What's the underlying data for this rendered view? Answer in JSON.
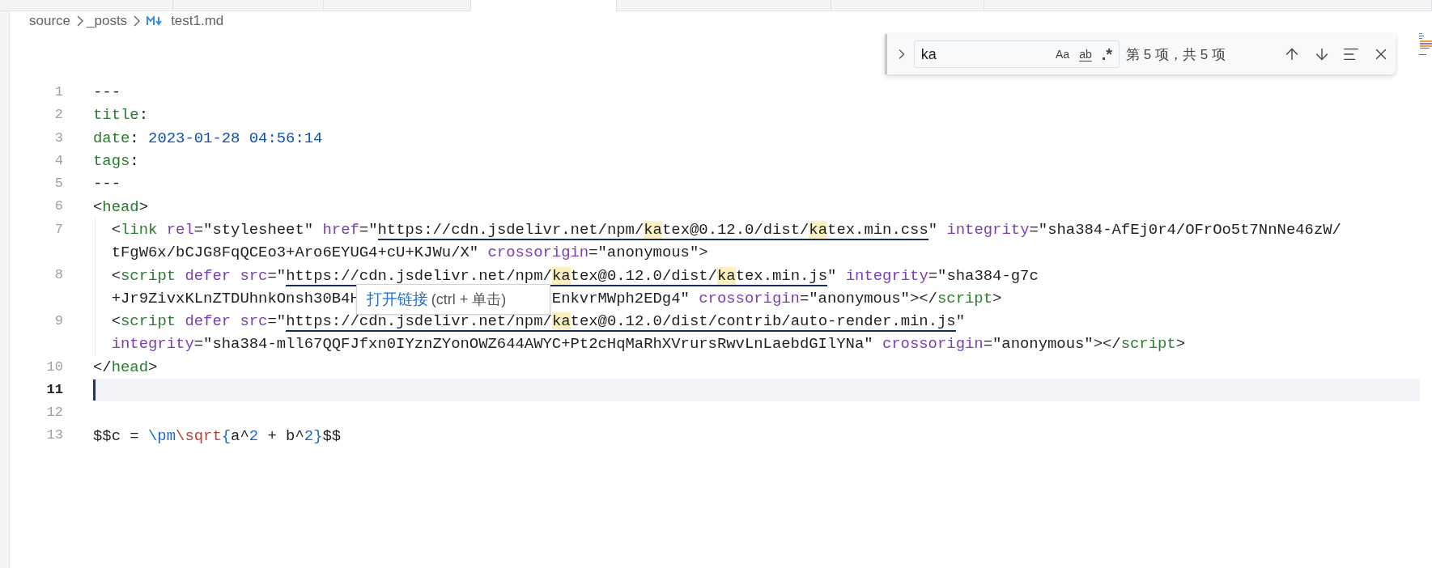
{
  "tabs": [
    {
      "selected": false
    },
    {
      "selected": false
    },
    {
      "selected": false
    },
    {
      "selected": true
    },
    {
      "selected": false
    },
    {
      "selected": false
    },
    {
      "selected": false
    }
  ],
  "breadcrumb": {
    "folders": [
      "source",
      "_posts"
    ],
    "file": "test1.md"
  },
  "find_widget": {
    "query": "ka",
    "options": [
      "Aa",
      "ab",
      ".*"
    ],
    "result": "第 5 项，共 5 项"
  },
  "lines": [
    {
      "number": "1",
      "current": false,
      "indented": false,
      "rows": [
        {
          "tokens": [
            {
              "text": "---",
              "kind": "plain"
            }
          ]
        }
      ]
    },
    {
      "number": "2",
      "current": false,
      "indented": false,
      "rows": [
        {
          "tokens": [
            {
              "text": "title",
              "kind": "key"
            },
            {
              "text": ":",
              "kind": "plain"
            }
          ]
        }
      ]
    },
    {
      "number": "3",
      "current": false,
      "indented": false,
      "rows": [
        {
          "tokens": [
            {
              "text": "date",
              "kind": "key"
            },
            {
              "text": ": ",
              "kind": "plain"
            },
            {
              "text": "2023-01-28 04:56:14",
              "kind": "value"
            }
          ]
        }
      ]
    },
    {
      "number": "4",
      "current": false,
      "indented": false,
      "rows": [
        {
          "tokens": [
            {
              "text": "tags",
              "kind": "key"
            },
            {
              "text": ":",
              "kind": "plain"
            }
          ]
        }
      ]
    },
    {
      "number": "5",
      "current": false,
      "indented": false,
      "rows": [
        {
          "tokens": [
            {
              "text": "---",
              "kind": "plain"
            }
          ]
        }
      ]
    },
    {
      "number": "6",
      "current": false,
      "indented": false,
      "rows": [
        {
          "tokens": [
            {
              "text": "<",
              "kind": "plain"
            },
            {
              "text": "head",
              "kind": "tag"
            },
            {
              "text": ">",
              "kind": "plain"
            }
          ]
        }
      ]
    },
    {
      "number": "7",
      "current": false,
      "indented": true,
      "rows": [
        {
          "tokens": [
            {
              "text": "<",
              "kind": "plain"
            },
            {
              "text": "link",
              "kind": "tag"
            },
            {
              "text": " rel",
              "kind": "attr"
            },
            {
              "text": "=\"stylesheet\" ",
              "kind": "plain"
            },
            {
              "text": "href",
              "kind": "attr"
            },
            {
              "text": "=\"",
              "kind": "plain"
            },
            {
              "text": "https://cdn.jsdelivr.net/npm/",
              "kind": "url"
            },
            {
              "text": "ka",
              "kind": "match"
            },
            {
              "text": "tex@0.12.0/dist/",
              "kind": "url"
            },
            {
              "text": "ka",
              "kind": "match"
            },
            {
              "text": "tex.min.css",
              "kind": "url"
            },
            {
              "text": "\" ",
              "kind": "plain"
            },
            {
              "text": "integrity",
              "kind": "attr"
            },
            {
              "text": "=\"sha384-AfEj0r4/OFrOo5t7NnNe46zW/",
              "kind": "plain"
            }
          ]
        },
        {
          "tokens": [
            {
              "text": "tFgW6x/bCJG8FqQCEo3+Aro6EYUG4+cU+KJWu/X\" ",
              "kind": "plain"
            },
            {
              "text": "crossorigin",
              "kind": "attr"
            },
            {
              "text": "=\"anonymous\">",
              "kind": "plain"
            }
          ]
        }
      ]
    },
    {
      "number": "8",
      "current": false,
      "indented": true,
      "rows": [
        {
          "tokens": [
            {
              "text": "<",
              "kind": "plain"
            },
            {
              "text": "script",
              "kind": "tag"
            },
            {
              "text": " defer src",
              "kind": "attr"
            },
            {
              "text": "=\"",
              "kind": "plain"
            },
            {
              "text": "https://cdn.jsdelivr.net/npm/",
              "kind": "url"
            },
            {
              "text": "ka",
              "kind": "match"
            },
            {
              "text": "tex@0.12.0/dist/",
              "kind": "url"
            },
            {
              "text": "ka",
              "kind": "match"
            },
            {
              "text": "tex.min.js",
              "kind": "url"
            },
            {
              "text": "\" ",
              "kind": "plain"
            },
            {
              "text": "integrity",
              "kind": "attr"
            },
            {
              "text": "=\"sha384-g7c",
              "kind": "plain"
            }
          ]
        },
        {
          "tokens": [
            {
              "text": "+Jr9ZivxKLnZTDUhnkOnsh30B4H",
              "kind": "plain"
            }
          ],
          "tooltip": {
            "link": "打开链接",
            "hint": "(ctrl + 单击)"
          },
          "tokens_after": [
            {
              "text": "EnkvrMWph2EDg4\" ",
              "kind": "plain"
            },
            {
              "text": "crossorigin",
              "kind": "attr"
            },
            {
              "text": "=\"anonymous\"></",
              "kind": "plain"
            },
            {
              "text": "script",
              "kind": "tag"
            },
            {
              "text": ">",
              "kind": "plain"
            }
          ]
        }
      ]
    },
    {
      "number": "9",
      "current": false,
      "indented": true,
      "rows": [
        {
          "tokens": [
            {
              "text": "<",
              "kind": "plain"
            },
            {
              "text": "script",
              "kind": "tag"
            },
            {
              "text": " defer src",
              "kind": "attr"
            },
            {
              "text": "=\"",
              "kind": "plain"
            },
            {
              "text": "https://cdn.jsdelivr.net/npm/",
              "kind": "url"
            },
            {
              "text": "ka",
              "kind": "match"
            },
            {
              "text": "tex@0.12.0/dist/contrib/auto-render.min.js",
              "kind": "url"
            },
            {
              "text": "\"",
              "kind": "plain"
            }
          ]
        },
        {
          "tokens": [
            {
              "text": "integrity",
              "kind": "attr"
            },
            {
              "text": "=\"sha384-mll67QQFJfxn0IYznZYonOWZ644AWYC+Pt2cHqMaRhXVrursRwvLnLaebdGIlYNa\" ",
              "kind": "plain"
            },
            {
              "text": "crossorigin",
              "kind": "attr"
            },
            {
              "text": "=\"anonymous\"></",
              "kind": "plain"
            },
            {
              "text": "script",
              "kind": "tag"
            },
            {
              "text": ">",
              "kind": "plain"
            }
          ]
        }
      ]
    },
    {
      "number": "10",
      "current": false,
      "indented": false,
      "rows": [
        {
          "tokens": [
            {
              "text": "</",
              "kind": "plain"
            },
            {
              "text": "head",
              "kind": "tag"
            },
            {
              "text": ">",
              "kind": "plain"
            }
          ]
        }
      ]
    },
    {
      "number": "11",
      "current": true,
      "indented": false
    },
    {
      "number": "12",
      "current": false,
      "indented": false
    },
    {
      "number": "13",
      "current": false,
      "indented": false,
      "rows": [
        {
          "tokens": [
            {
              "text": "$$c = ",
              "kind": "plain"
            },
            {
              "text": "\\pm",
              "kind": "cmd"
            },
            {
              "text": "\\sqrt",
              "kind": "func"
            },
            {
              "text": "{",
              "kind": "cmd"
            },
            {
              "text": "a^",
              "kind": "plain"
            },
            {
              "text": "2",
              "kind": "cmd"
            },
            {
              "text": " + b^",
              "kind": "plain"
            },
            {
              "text": "2",
              "kind": "cmd"
            },
            {
              "text": "}",
              "kind": "cmd"
            },
            {
              "text": "$$",
              "kind": "plain"
            }
          ]
        }
      ]
    }
  ]
}
